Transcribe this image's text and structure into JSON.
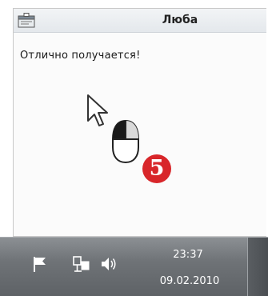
{
  "popup": {
    "title": "Люба",
    "message": "Отлично получается!",
    "app_icon": "app-window-icon"
  },
  "tutorial": {
    "cursor_icon": "arrow-cursor-icon",
    "mouse_icon": "mouse-left-click-icon",
    "step_number": "5",
    "step_color": "#d8262a"
  },
  "taskbar": {
    "tray_icons": [
      "flag-icon",
      "network-icon",
      "volume-icon"
    ],
    "clock": {
      "time": "23:37",
      "date": "09.02.2010"
    }
  }
}
